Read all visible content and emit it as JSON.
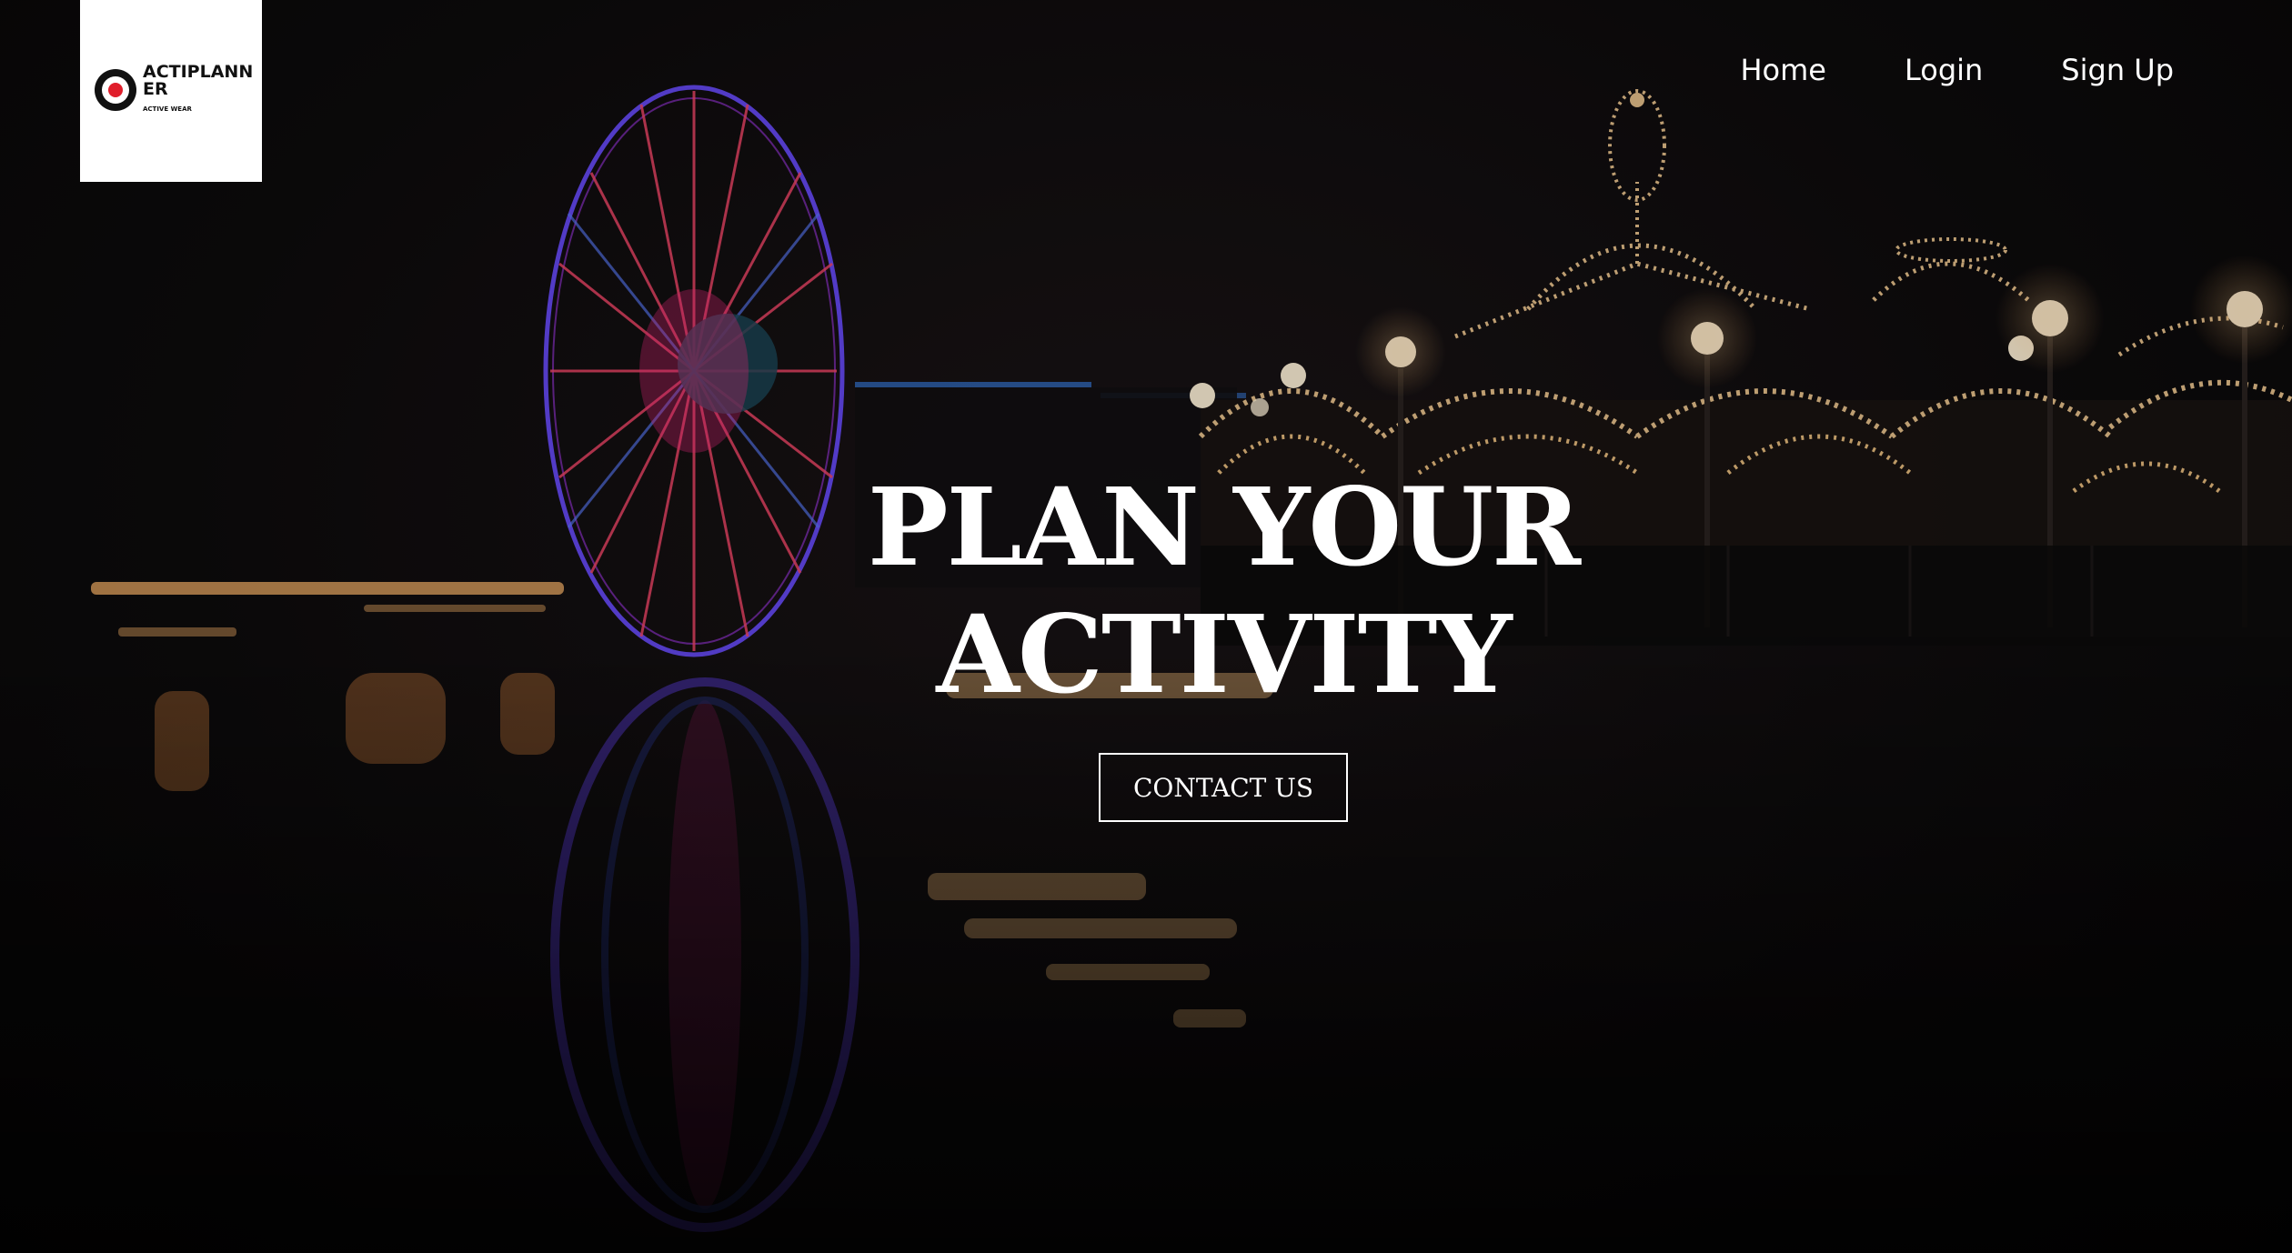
{
  "logo": {
    "name": "ACTIPLANNER",
    "tagline": "ACTIVE WEAR",
    "mark_icon": "target-icon"
  },
  "nav": {
    "items": [
      {
        "label": "Home"
      },
      {
        "label": "Login"
      },
      {
        "label": "Sign Up"
      }
    ]
  },
  "hero": {
    "title_line1": "PLAN YOUR",
    "title_line2": "ACTIVITY",
    "cta_label": "CONTACT US"
  },
  "colors": {
    "text": "#ffffff",
    "background": "#0f0d0e",
    "logo_accent": "#e01e2b"
  }
}
